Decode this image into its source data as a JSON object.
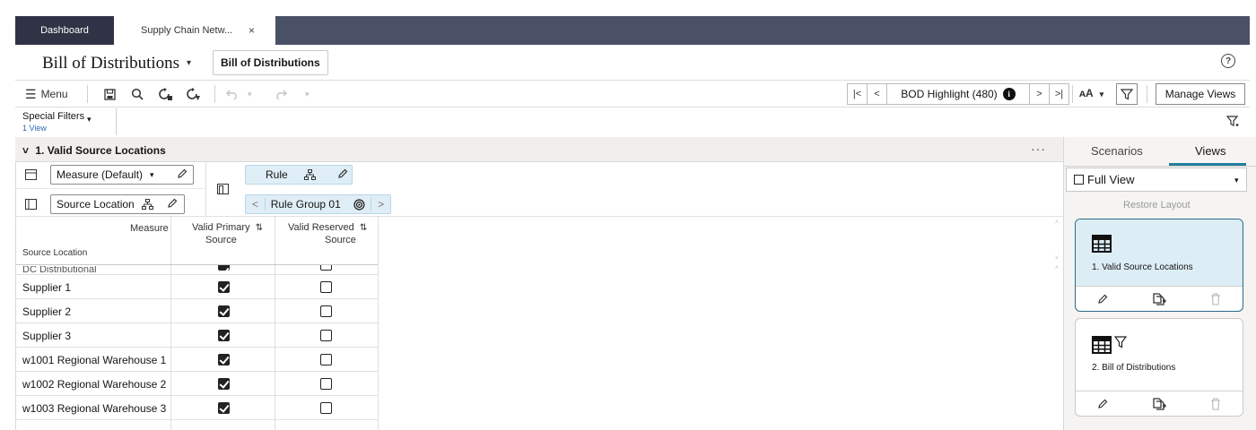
{
  "tabs": [
    {
      "label": "Dashboard"
    },
    {
      "label": "Supply Chain Netw...",
      "close": "×"
    }
  ],
  "header": {
    "title": "Bill of Distributions",
    "title_chevron": "▾",
    "chip_label": "Bill of Distributions",
    "help": "?"
  },
  "toolbar": {
    "menu_label": "Menu",
    "nav_first": "|<",
    "nav_prev": "<",
    "highlight_label": "BOD Highlight (480)",
    "info": "i",
    "nav_next": ">",
    "nav_last": ">|",
    "text_size": "ᴀA",
    "text_size_caret": "▾",
    "manage_views_label": "Manage Views"
  },
  "special_filters": {
    "label": "Special Filters",
    "sub": "1 View",
    "caret": "▾"
  },
  "section": {
    "title": "1. Valid Source Locations",
    "chevron": "˅",
    "more": "···"
  },
  "layout": {
    "measure_label": "Measure (Default)",
    "measure_caret": "▾",
    "source_location_label": "Source Location",
    "rule_label": "Rule",
    "rule_group_label": "Rule Group 01",
    "rule_group_prev": "<",
    "rule_group_next": ">"
  },
  "grid": {
    "corner_top": "Measure",
    "corner_bottom": "Source Location",
    "col1_line1": "Valid Primary",
    "col1_line2": "Source",
    "col2_line1": "Valid Reserved",
    "col2_line2": "Source",
    "sort_icon": "⇅",
    "partial_row": "DC Distributional",
    "rows": [
      {
        "label": "Supplier 1",
        "primary": true,
        "reserved": false
      },
      {
        "label": "Supplier 2",
        "primary": true,
        "reserved": false
      },
      {
        "label": "Supplier 3",
        "primary": true,
        "reserved": false
      },
      {
        "label": "w1001 Regional Warehouse 1",
        "primary": true,
        "reserved": false
      },
      {
        "label": "w1002 Regional Warehouse 2",
        "primary": true,
        "reserved": false
      },
      {
        "label": "w1003 Regional Warehouse 3",
        "primary": true,
        "reserved": false
      }
    ]
  },
  "right_panel": {
    "tab_scenarios": "Scenarios",
    "tab_views": "Views",
    "full_view": "Full View",
    "full_view_caret": "▾",
    "restore_layout": "Restore Layout",
    "cards": [
      {
        "title": "1. Valid Source Locations",
        "selected": true
      },
      {
        "title": "2. Bill of Distributions",
        "selected": false
      }
    ]
  },
  "colors": {
    "tabbar": "#4a5066",
    "accent": "#227e9e",
    "selected_card": "#dcedf6"
  }
}
